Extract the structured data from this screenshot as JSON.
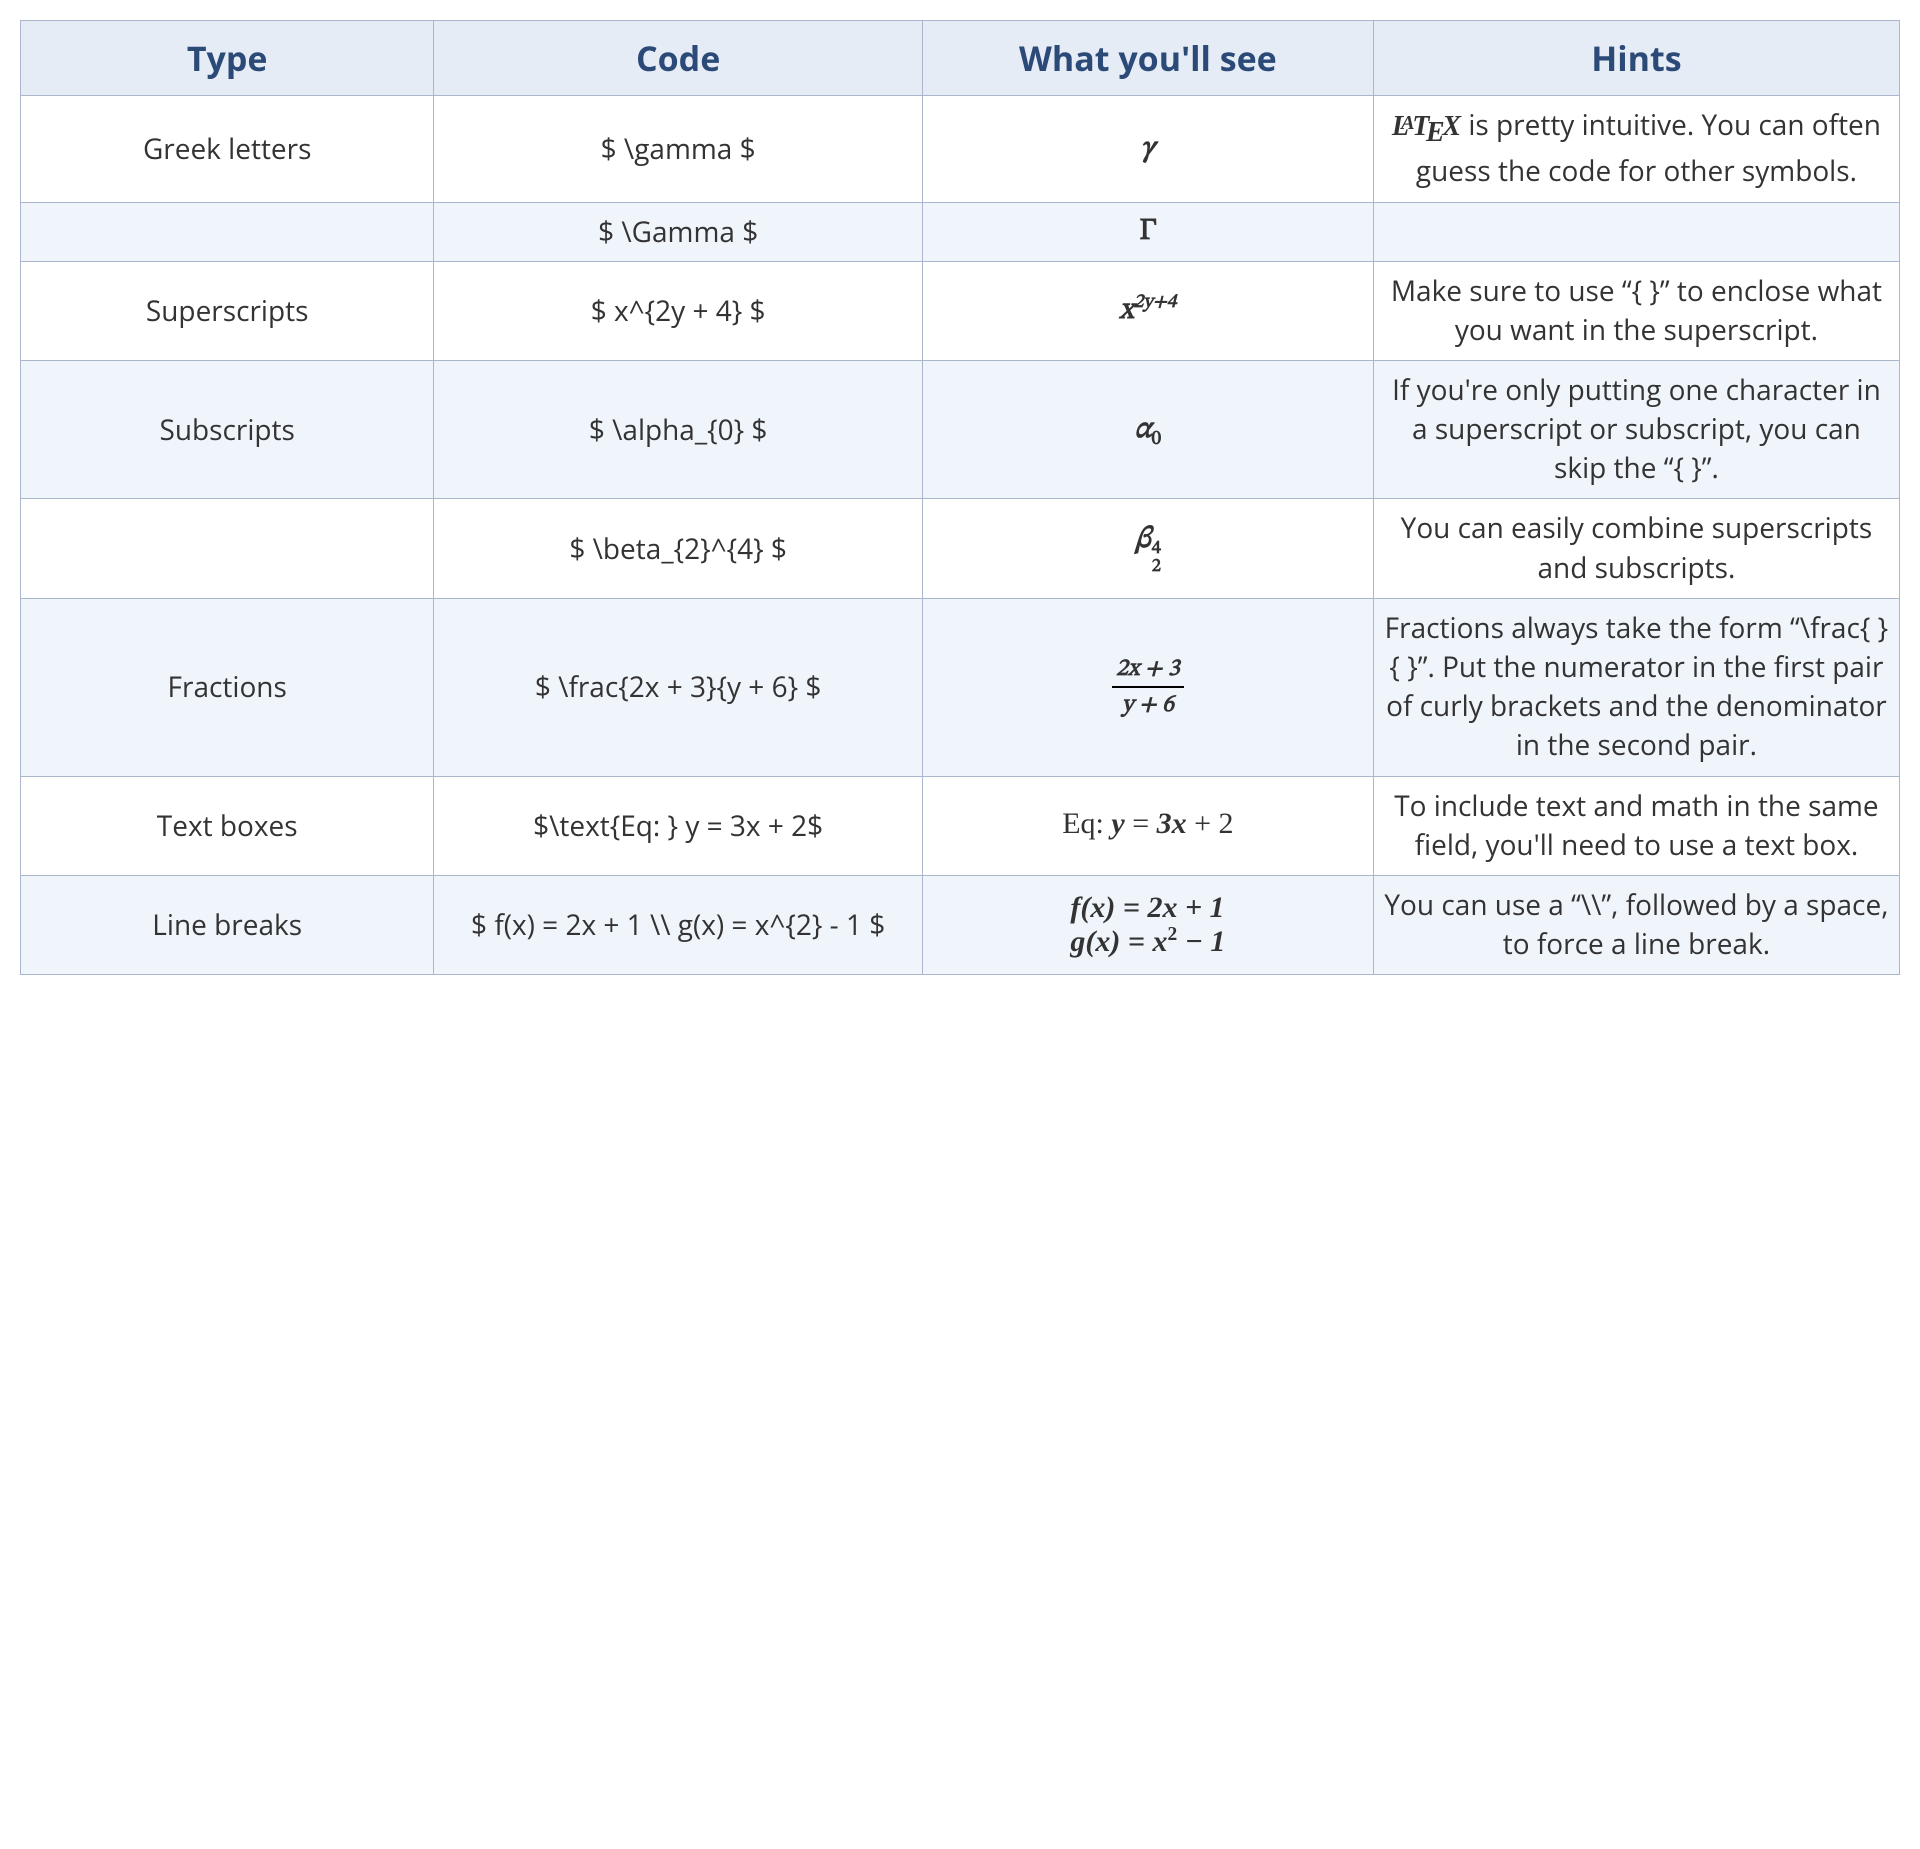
{
  "headers": [
    "Type",
    "Code",
    "What you'll see",
    "Hints"
  ],
  "rows": [
    {
      "type": "Greek letters",
      "code": "$ \\gamma $",
      "hint_prefix": " is pretty intuitive. You can often guess the code for other symbols."
    },
    {
      "type": "",
      "code": "$ \\Gamma $",
      "hint": ""
    },
    {
      "type": "Superscripts",
      "code": "$ x^{2y + 4} $",
      "hint": "Make sure to use “{ }” to enclose what you want in the superscript."
    },
    {
      "type": "Subscripts",
      "code": "$ \\alpha_{0} $",
      "hint": "If you're only putting one character in a superscript or subscript, you can skip the “{ }”."
    },
    {
      "type": "",
      "code": "$ \\beta_{2}^{4} $",
      "hint": "You can easily combine superscripts and subscripts."
    },
    {
      "type": "Fractions",
      "code": "$ \\frac{2x + 3}{y + 6} $",
      "hint": "Fractions always take the form “\\frac{ }{ }”. Put the numerator in the first pair of curly brackets and the denominator in the second pair."
    },
    {
      "type": "Text boxes",
      "code": "$\\text{Eq: } y = 3x + 2$",
      "hint": "To include text and math in the same field, you'll need to use a text box."
    },
    {
      "type": "Line breaks",
      "code": "$ f(x) = 2x + 1 \\\\ g(x) = x^{2} - 1 $",
      "hint": "You can use a “\\\\”, followed by a space, to force a line break."
    }
  ],
  "rendered": {
    "gamma_lower": "γ",
    "gamma_upper": "Γ",
    "frac_num": "2x + 3",
    "frac_den": "y + 6",
    "eq_text": "Eq: ",
    "eq_rest_y": "y",
    "eq_rest_eq": " = ",
    "eq_rest_3x": "3x",
    "eq_rest_plus2": " + 2",
    "line1_f": "f(x) = 2x + 1",
    "line2_g_pre": "g(x) = x",
    "line2_g_sup": "2",
    "line2_g_post": " − 1"
  }
}
